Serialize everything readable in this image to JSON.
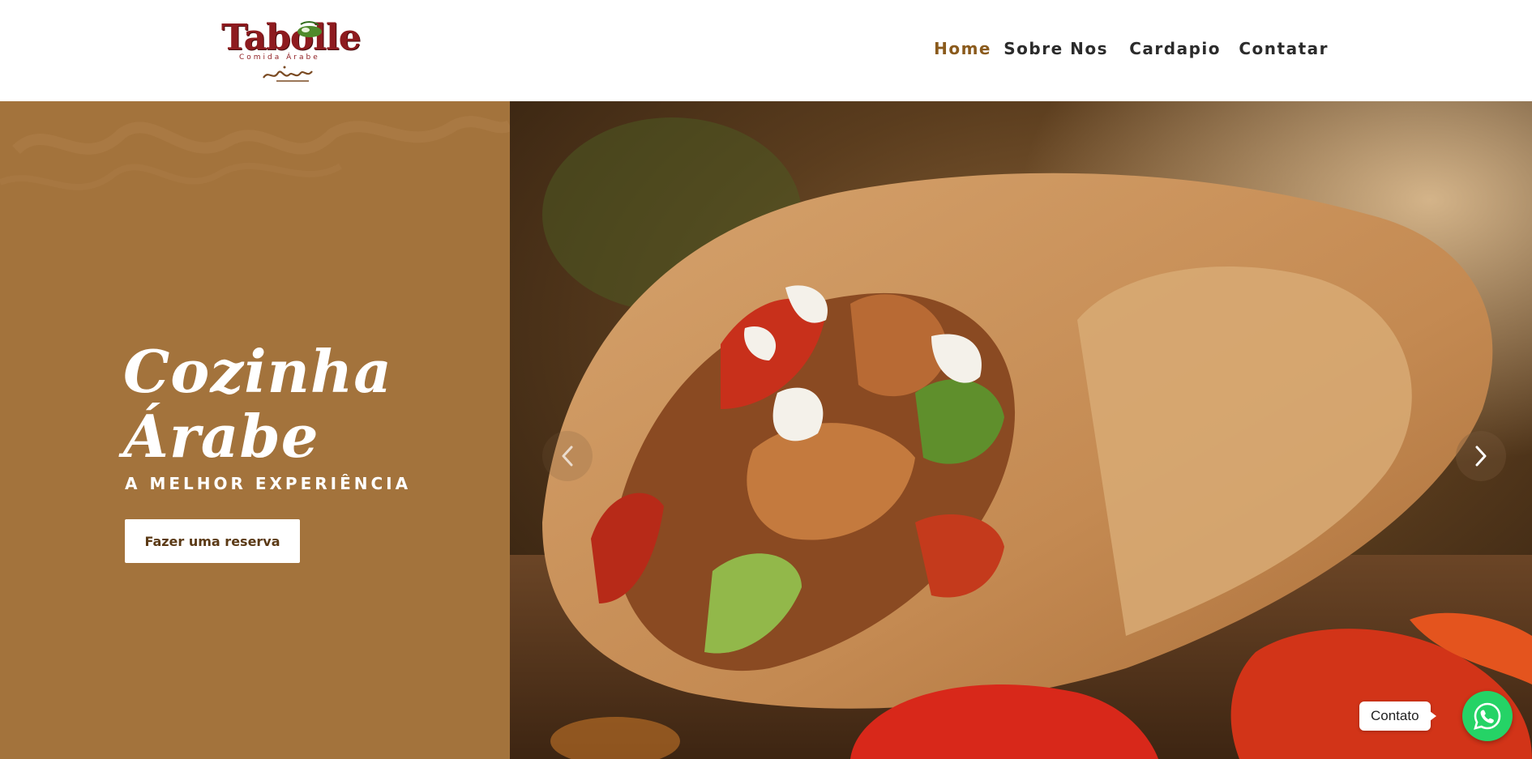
{
  "brand": {
    "name": "Tabolle",
    "tagline": "Comida Árabe",
    "colors": {
      "logo": "#8e1b1f",
      "accent": "#a3733c",
      "nav_active": "#8a5a1c",
      "whatsapp": "#25d366"
    }
  },
  "nav": {
    "items": [
      {
        "label": "Home",
        "active": true
      },
      {
        "label": "Sobre Nos",
        "active": false
      },
      {
        "label": "Cardapio",
        "active": false
      },
      {
        "label": "Contatar",
        "active": false
      }
    ]
  },
  "hero": {
    "title_line1": "Cozinha",
    "title_line2": "Árabe",
    "subtitle": "A MELHOR EXPERIÊNCIA",
    "cta_label": "Fazer uma reserva",
    "prev_icon": "chevron-left-icon",
    "next_icon": "chevron-right-icon"
  },
  "contact": {
    "label": "Contato",
    "icon": "whatsapp-icon"
  }
}
